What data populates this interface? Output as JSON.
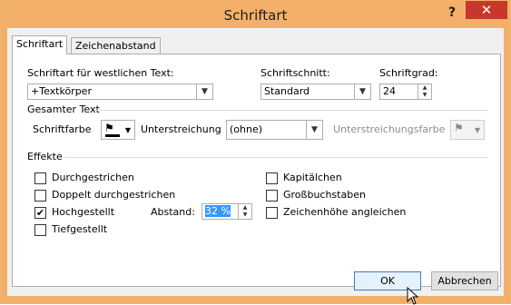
{
  "window": {
    "title": "Schriftart",
    "help": "?",
    "close": "✕"
  },
  "tabs": [
    {
      "label": "Schriftart"
    },
    {
      "label": "Zeichenabstand"
    }
  ],
  "font": {
    "label": "Schriftart für westlichen Text:",
    "value": "+Textkörper"
  },
  "style": {
    "label": "Schriftschnitt:",
    "value": "Standard"
  },
  "size": {
    "label": "Schriftgrad:",
    "value": "24"
  },
  "section_all_text": "Gesamter Text",
  "font_color_label": "Schriftfarbe",
  "underline": {
    "label": "Unterstreichung",
    "value": "(ohne)"
  },
  "underline_color_label": "Unterstreichungsfarbe",
  "section_effects": "Effekte",
  "effects": {
    "strikethrough": "Durchgestrichen",
    "double_strikethrough": "Doppelt durchgestrichen",
    "superscript": "Hochgestellt",
    "subscript": "Tiefgestellt",
    "small_caps": "Kapitälchen",
    "all_caps": "Großbuchstaben",
    "equalize_height": "Zeichenhöhe angleichen"
  },
  "offset": {
    "label": "Abstand:",
    "value": "32 %"
  },
  "buttons": {
    "ok": "OK",
    "cancel": "Abbrechen"
  },
  "colors": {
    "titlebar": "#f4b06b",
    "close": "#c7372b"
  }
}
